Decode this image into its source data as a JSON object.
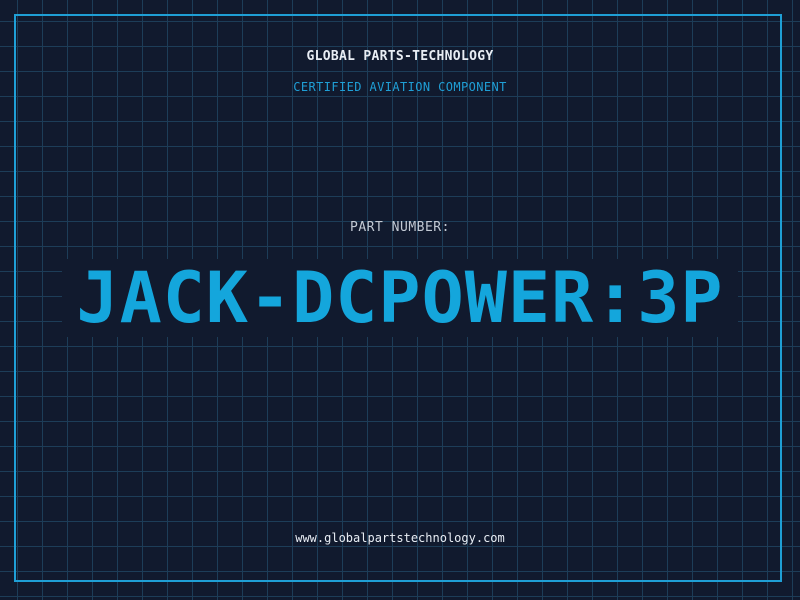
{
  "header": {
    "brand": "GLOBAL PARTS-TECHNOLOGY",
    "subtitle": "CERTIFIED AVIATION COMPONENT"
  },
  "part": {
    "label": "PART NUMBER:",
    "number": "JACK-DCPOWER:3P"
  },
  "footer": {
    "website": "www.globalpartstechnology.com"
  },
  "colors": {
    "background": "#111a2e",
    "grid": "#1d3d58",
    "accent": "#1f9fd6",
    "part_number": "#14a6dc",
    "text_light": "#e8edf4",
    "text_muted": "#c3cad4"
  }
}
